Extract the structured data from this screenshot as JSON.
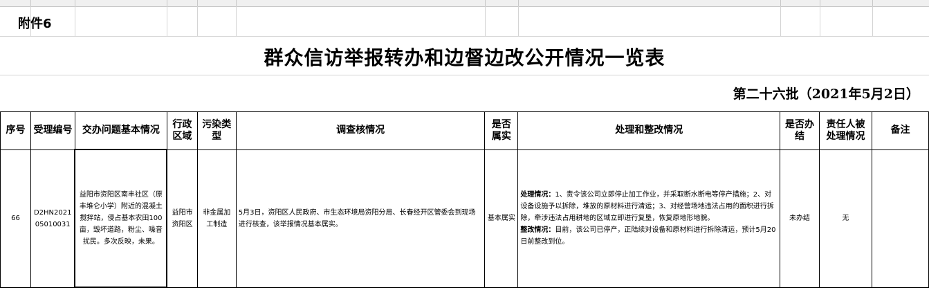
{
  "attachment_label": "附件6",
  "title": "群众信访举报转办和边督边改公开情况一览表",
  "batch": "第二十六批（2021年5月2日）",
  "columns": [
    "序号",
    "受理编号",
    "交办问题基本情况",
    "行政区域",
    "污染类型",
    "调查核情况",
    "是否属实",
    "处理和整改情况",
    "是否办结",
    "责任人被处理情况",
    "备注"
  ],
  "rows": [
    {
      "seq": "66",
      "id_line1": "D2HN2021",
      "id_line2": "05010031",
      "issue": "益阳市资阳区南丰社区（原丰堆仑小学）附近的混凝土搅拌站，侵占基本农田100亩，毁坏道路，粉尘、噪音扰民。多次反映，未果。",
      "region": "益阳市资阳区",
      "pollution": "非金属加工制造",
      "investigation": "5月3日，资阳区人民政府、市生态环境局资阳分局、长春经开区管委会到现场进行核查，该举报情况基本属实。",
      "verified": "基本属实",
      "handling_label": "处理情况：",
      "handling_text": "1、责令该公司立即停止加工作业，并采取断水断电等停产措施；2、对设备设施予以拆除，堆放的原材料进行清运；3、对经营场地违法占用的面积进行拆除，牵涉违法占用耕地的区域立即进行复垦，恢复原地形地貌。",
      "rectify_label": "整改情况：",
      "rectify_text": "目前，该公司已停产，正陆续对设备和原材料进行拆除清运，预计5月20日前整改到位。",
      "completed": "未办结",
      "responsible": "无",
      "remark": ""
    }
  ]
}
